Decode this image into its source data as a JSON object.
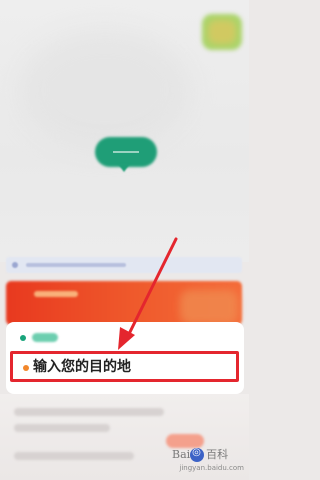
{
  "destination": {
    "placeholder_text": "输入您的目的地"
  },
  "watermark": {
    "brand": "Bai",
    "label": "百科",
    "domain": "jingyan.baidu.com"
  },
  "colors": {
    "annotation_red": "#e4262e",
    "start_dot": "#19a47b",
    "destination_dot": "#f2872b",
    "promo_banner": "#e8391f",
    "location_pill": "#1f9e77"
  },
  "icons": {
    "corner_button": "menu-icon",
    "location_marker": "location-pin-icon",
    "watermark_logo": "baidu-logo-icon"
  }
}
